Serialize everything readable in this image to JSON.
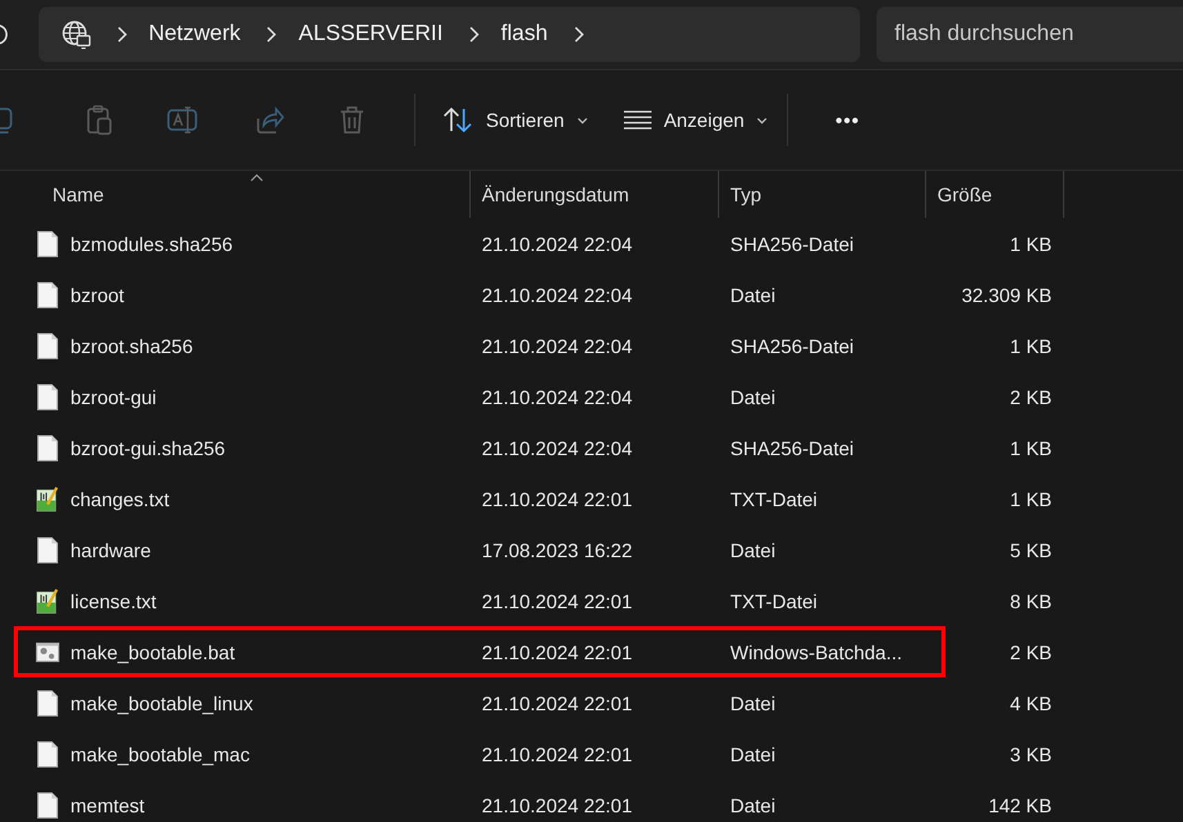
{
  "breadcrumb": [
    "Netzwerk",
    "ALSSERVERII",
    "flash"
  ],
  "search": {
    "placeholder": "flash durchsuchen"
  },
  "toolbar": {
    "sort_label": "Sortieren",
    "view_label": "Anzeigen",
    "more_label": "•••"
  },
  "table": {
    "columns": [
      "Name",
      "Änderungsdatum",
      "Typ",
      "Größe"
    ],
    "rows": [
      {
        "kind": "file",
        "name": "bzmodules.sha256",
        "date": "21.10.2024 22:04",
        "type": "SHA256-Datei",
        "size": "1 KB",
        "highlighted": false
      },
      {
        "kind": "file",
        "name": "bzroot",
        "date": "21.10.2024 22:04",
        "type": "Datei",
        "size": "32.309 KB",
        "highlighted": false
      },
      {
        "kind": "file",
        "name": "bzroot.sha256",
        "date": "21.10.2024 22:04",
        "type": "SHA256-Datei",
        "size": "1 KB",
        "highlighted": false
      },
      {
        "kind": "file",
        "name": "bzroot-gui",
        "date": "21.10.2024 22:04",
        "type": "Datei",
        "size": "2 KB",
        "highlighted": false
      },
      {
        "kind": "file",
        "name": "bzroot-gui.sha256",
        "date": "21.10.2024 22:04",
        "type": "SHA256-Datei",
        "size": "1 KB",
        "highlighted": false
      },
      {
        "kind": "text",
        "name": "changes.txt",
        "date": "21.10.2024 22:01",
        "type": "TXT-Datei",
        "size": "1 KB",
        "highlighted": false
      },
      {
        "kind": "file",
        "name": "hardware",
        "date": "17.08.2023 16:22",
        "type": "Datei",
        "size": "5 KB",
        "highlighted": false
      },
      {
        "kind": "text",
        "name": "license.txt",
        "date": "21.10.2024 22:01",
        "type": "TXT-Datei",
        "size": "8 KB",
        "highlighted": false
      },
      {
        "kind": "batch",
        "name": "make_bootable.bat",
        "date": "21.10.2024 22:01",
        "type": "Windows-Batchda...",
        "size": "2 KB",
        "highlighted": true
      },
      {
        "kind": "file",
        "name": "make_bootable_linux",
        "date": "21.10.2024 22:01",
        "type": "Datei",
        "size": "4 KB",
        "highlighted": false
      },
      {
        "kind": "file",
        "name": "make_bootable_mac",
        "date": "21.10.2024 22:01",
        "type": "Datei",
        "size": "3 KB",
        "highlighted": false
      },
      {
        "kind": "file",
        "name": "memtest",
        "date": "21.10.2024 22:01",
        "type": "Datei",
        "size": "142 KB",
        "highlighted": false
      }
    ]
  }
}
